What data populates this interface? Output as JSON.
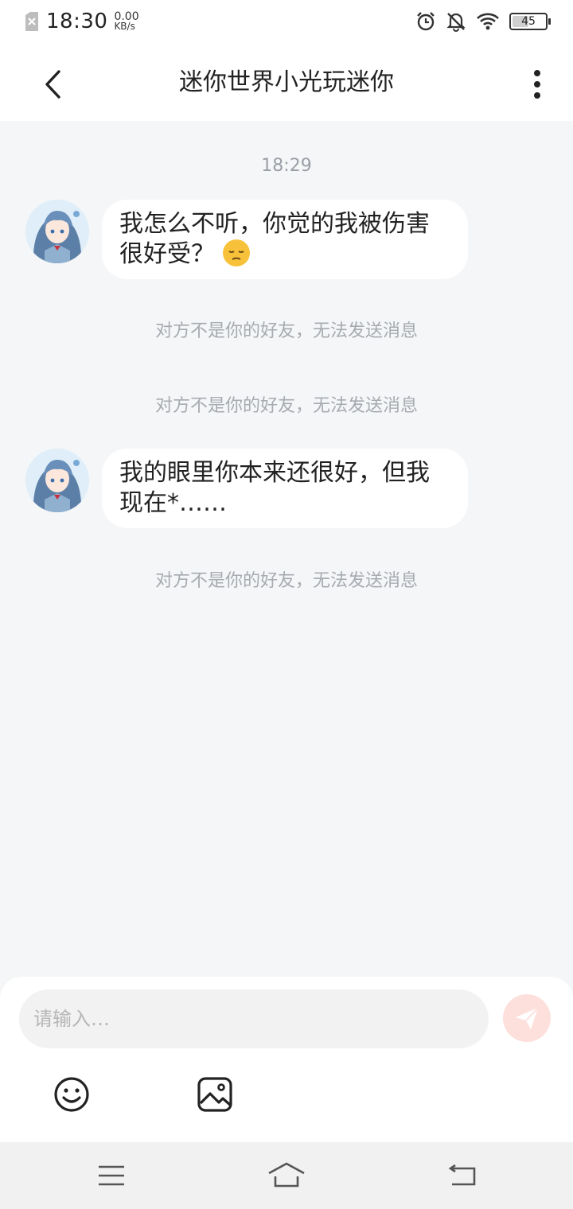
{
  "status_bar": {
    "time": "18:30",
    "net_speed_value": "0.00",
    "net_speed_unit": "KB/s",
    "battery_level": "45",
    "icons": [
      "sim-off-icon",
      "alarm-icon",
      "notification-off-icon",
      "wifi-icon",
      "battery-icon"
    ]
  },
  "header": {
    "title": "迷你世界小光玩迷你",
    "back_icon": "chevron-left-icon",
    "more_icon": "more-vertical-icon"
  },
  "chat": {
    "timestamp": "18:29",
    "messages": [
      {
        "text_before_emoji": "我怎么不听，你觉的我被伤害很好受？",
        "emoji": "pensive-face-emoji"
      },
      {
        "text": "我的眼里你本来还很好，但我现在*……"
      }
    ],
    "system_notes": [
      "对方不是你的好友，无法发送消息",
      "对方不是你的好友，无法发送消息",
      "对方不是你的好友，无法发送消息"
    ]
  },
  "composer": {
    "placeholder": "请输入…",
    "send_icon": "send-icon",
    "tools": [
      "emoji-icon",
      "image-icon"
    ]
  },
  "colors": {
    "chat_background": "#f4f6f8",
    "bubble": "#ffffff",
    "system_text": "#a7abb0",
    "send_button": "#fde0dc"
  },
  "nav_bar": {
    "icons": [
      "menu-icon",
      "home-icon",
      "back-icon"
    ]
  }
}
